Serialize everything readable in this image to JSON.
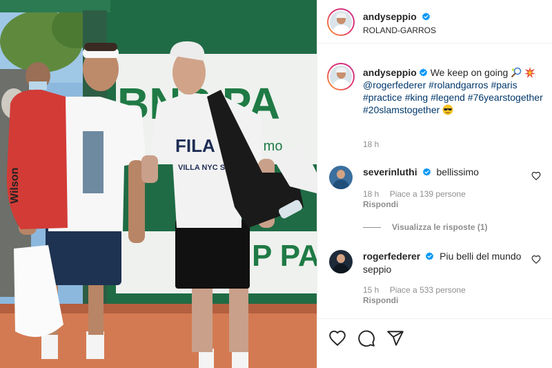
{
  "photo": {
    "banner_text_large": "BNP PA",
    "banner_text_small": "n mo",
    "banner_text_lower": "P PA",
    "shirt_brand": "FILA",
    "shirt_text": "VILLA NYC SEOUL",
    "bag_brand": "Wilson",
    "description_icon": "photo"
  },
  "header": {
    "username": "andyseppio",
    "location": "ROLAND-GARROS"
  },
  "caption": {
    "username": "andyseppio",
    "text_1": "We keep on going",
    "mention": "@rogerfederer",
    "tags": [
      "#rolandgarros",
      "#paris",
      "#practice",
      "#king",
      "#legend",
      "#76yearstogether",
      "#20slamstogether"
    ],
    "time": "18 h"
  },
  "comments": [
    {
      "username": "severinluthi",
      "text": "bellissimo",
      "time": "18 h",
      "likes": "Piace a 139 persone",
      "reply": "Rispondi"
    },
    {
      "username": "rogerfederer",
      "text": "Piu belli del mundo seppio",
      "time": "15 h",
      "likes": "Piace a 533 persone",
      "reply": "Rispondi"
    }
  ],
  "view_replies": "Visualizza le risposte (1)",
  "colors": {
    "link": "#00376b",
    "verified": "#0095f6",
    "muted": "#8e8e8e",
    "border": "#efefef"
  },
  "icons": [
    "verified-icon",
    "tennis-racket-emoji",
    "collision-emoji",
    "sunglasses-emoji",
    "heart-icon",
    "comment-icon",
    "share-icon"
  ]
}
